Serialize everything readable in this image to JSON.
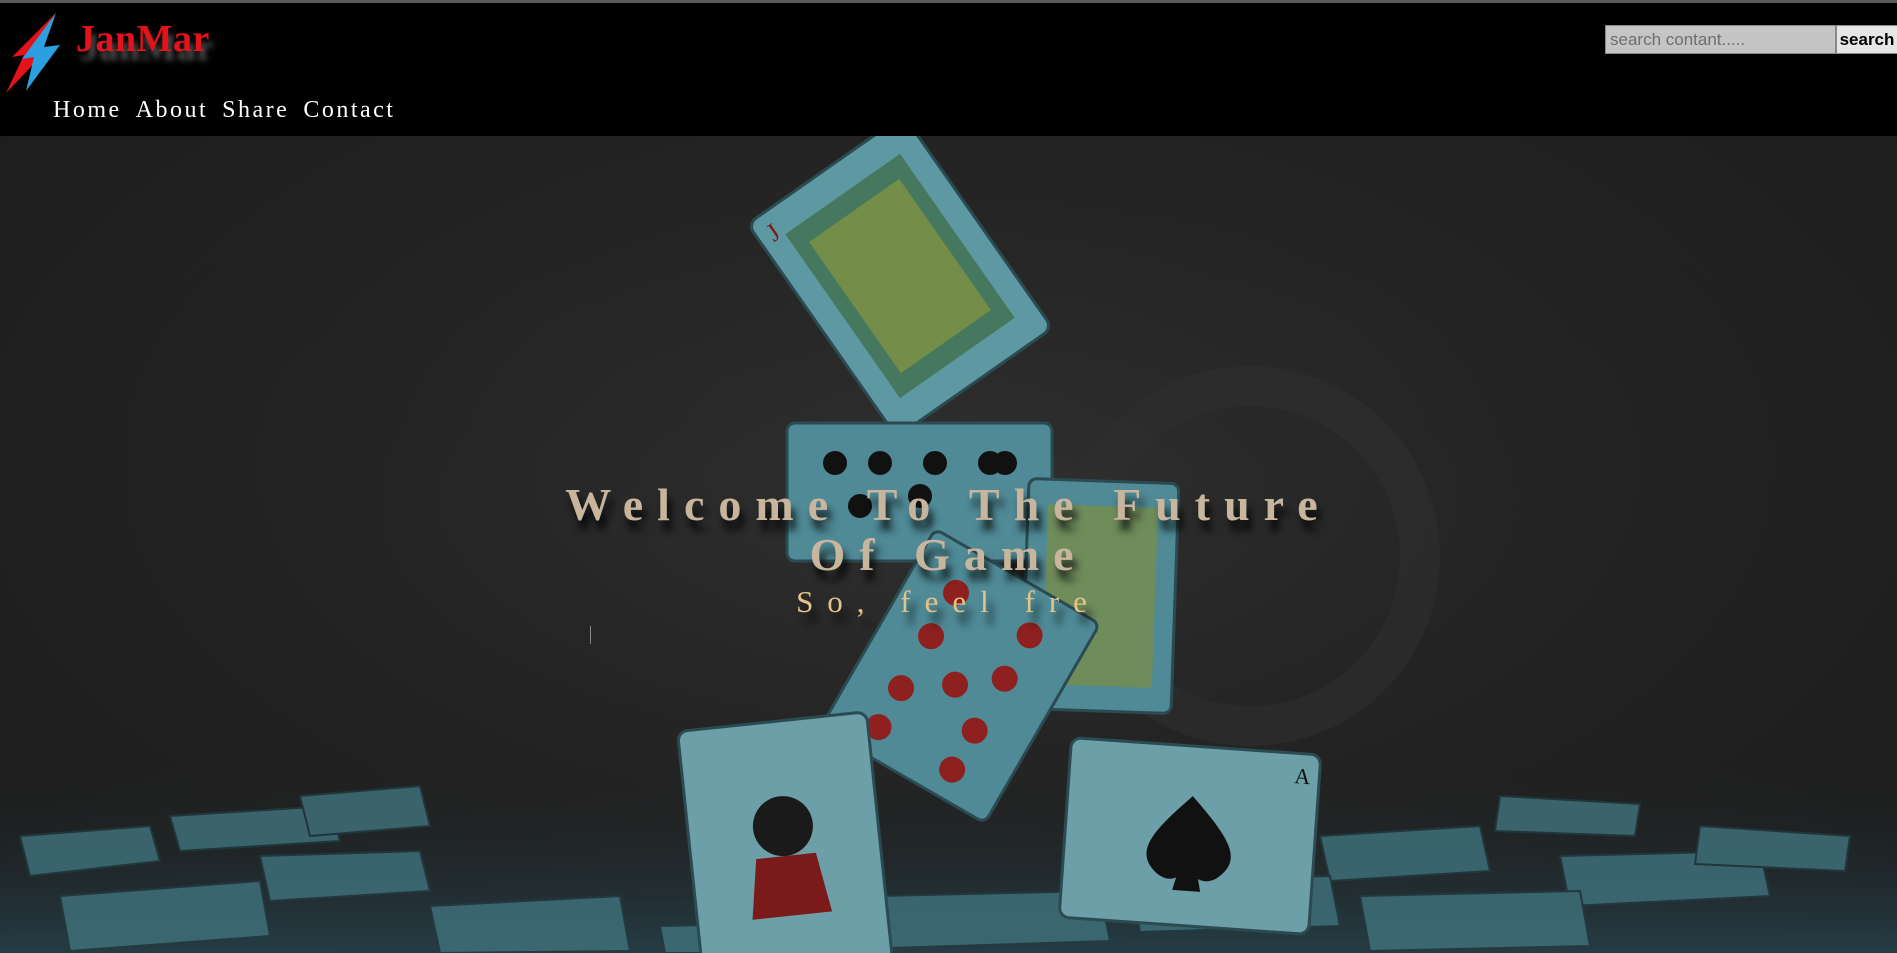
{
  "brand": {
    "name": "JanMar",
    "color": "#e3121b",
    "logo_icon": "lightning-bolt-icon"
  },
  "nav": {
    "items": [
      {
        "label": "Home"
      },
      {
        "label": "About"
      },
      {
        "label": "Share"
      },
      {
        "label": "Contact"
      }
    ]
  },
  "search": {
    "placeholder": "search contant.....",
    "value": "",
    "button_label": "search"
  },
  "hero": {
    "title_line1": "Welcome To The Future",
    "title_line2": "Of Game",
    "subtitle": "So, feel fre",
    "background_image": "falling-playing-cards-image"
  },
  "colors": {
    "header_bg": "#000000",
    "hero_title": "#c7b59d",
    "hero_subtitle": "#e6c387",
    "card_face": "#4f8a96"
  }
}
